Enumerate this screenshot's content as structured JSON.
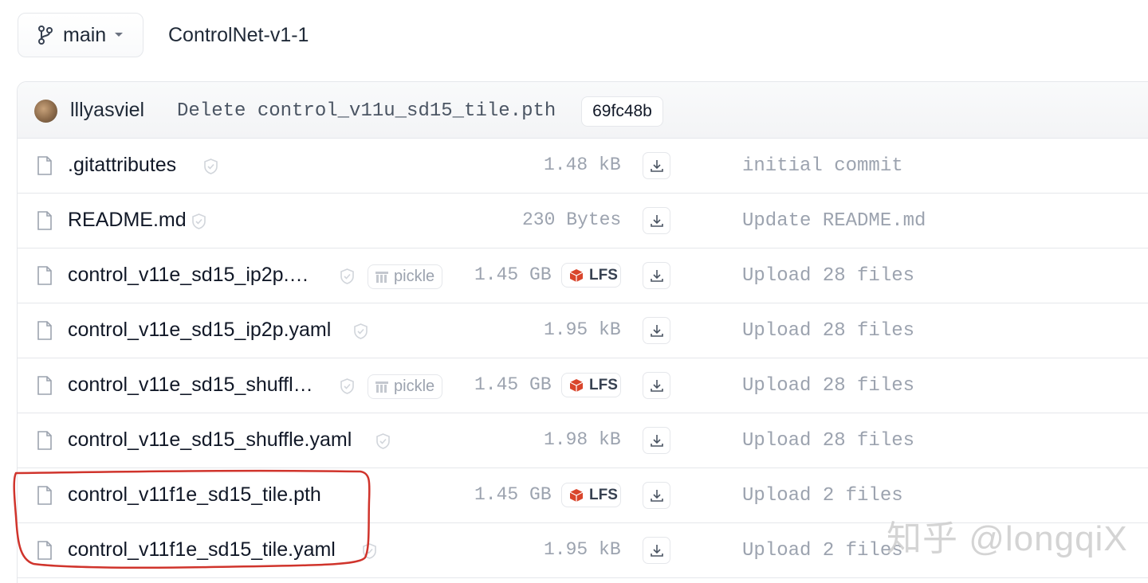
{
  "header": {
    "branch": "main",
    "repo": "ControlNet-v1-1"
  },
  "commit": {
    "author": "lllyasviel",
    "message": "Delete control_v11u_sd15_tile.pth",
    "hash": "69fc48b"
  },
  "files": [
    {
      "name": ".gitattributes",
      "size": "1.48 kB",
      "commit": "initial commit"
    },
    {
      "name": "README.md",
      "size": "230 Bytes",
      "commit": "Update README.md"
    },
    {
      "name": "control_v11e_sd15_ip2p.…",
      "size": "1.45 GB",
      "commit": "Upload 28 files",
      "pickle": "pickle",
      "lfs": "LFS"
    },
    {
      "name": "control_v11e_sd15_ip2p.yaml",
      "size": "1.95 kB",
      "commit": "Upload 28 files"
    },
    {
      "name": "control_v11e_sd15_shuffl…",
      "size": "1.45 GB",
      "commit": "Upload 28 files",
      "pickle": "pickle",
      "lfs": "LFS"
    },
    {
      "name": "control_v11e_sd15_shuffle.yaml",
      "size": "1.98 kB",
      "commit": "Upload 28 files"
    },
    {
      "name": "control_v11f1e_sd15_tile.pth",
      "size": "1.45 GB",
      "commit": "Upload 2 files",
      "lfs": "LFS"
    },
    {
      "name": "control_v11f1e_sd15_tile.yaml",
      "size": "1.95 kB",
      "commit": "Upload 2 files"
    }
  ],
  "watermark": "知乎 @longqiX",
  "colors": {
    "highlight": "#d0342c",
    "lfs_red": "#d9452b",
    "muted": "#9ca3af",
    "border": "#e5e7eb"
  },
  "icons": {
    "branch": "git-branch-icon",
    "file": "file-icon",
    "safe": "shield-check-icon",
    "download": "download-icon",
    "lfs": "lfs-cube-icon",
    "pickle": "pickle-icon"
  }
}
